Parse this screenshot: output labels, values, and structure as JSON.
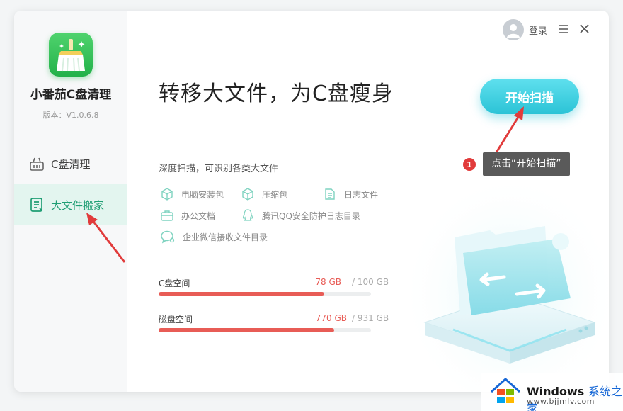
{
  "app": {
    "name": "小番茄C盘清理",
    "version": "版本：V1.0.6.8"
  },
  "sidebar": {
    "items": [
      {
        "label": "C盘清理",
        "icon": "basket-icon",
        "active": false
      },
      {
        "label": "大文件搬家",
        "icon": "document-list-icon",
        "active": true
      }
    ]
  },
  "header": {
    "login_label": "登录"
  },
  "main": {
    "headline": "转移大文件，为C盘瘦身",
    "scan_button": "开始扫描",
    "subtitle": "深度扫描，可识别各类大文件",
    "features": [
      {
        "label": "电脑安装包",
        "icon": "cube-icon"
      },
      {
        "label": "压缩包",
        "icon": "cube-icon"
      },
      {
        "label": "日志文件",
        "icon": "file-lines-icon"
      },
      {
        "label": "办公文档",
        "icon": "briefcase-icon"
      },
      {
        "label": "腾讯QQ安全防护日志目录",
        "icon": "qq-icon"
      },
      {
        "label": "企业微信接收文件目录",
        "icon": "wechat-work-icon"
      }
    ],
    "storage": [
      {
        "label": "C盘空间",
        "used": "78 GB",
        "total": "/ 100 GB",
        "fraction": 0.78
      },
      {
        "label": "磁盘空间",
        "used": "770 GB",
        "total": "/ 931 GB",
        "fraction": 0.827
      }
    ]
  },
  "annotation": {
    "step_number": "1",
    "tooltip": "点击“开始扫描”"
  },
  "watermark": {
    "brand": "Windows",
    "brand_cn": "系统之家",
    "url": "www.bjjmlv.com"
  },
  "colors": {
    "accent_green": "#1f9e74",
    "scan_button": "#2bc3d6",
    "bar_fill": "#e85c56",
    "annotation_red": "#e13b3b"
  }
}
